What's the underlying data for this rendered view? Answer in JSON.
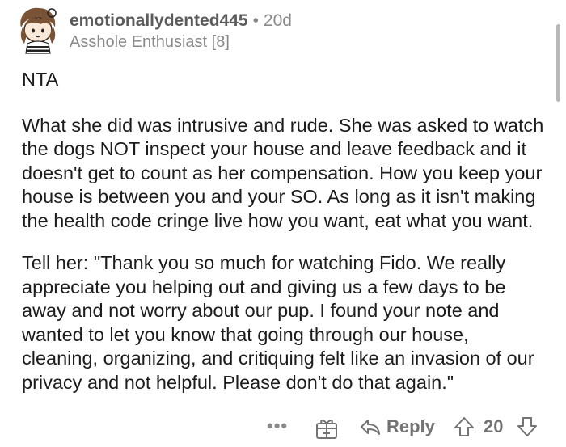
{
  "comment": {
    "author": "emotionallydented445",
    "separator": "•",
    "age": "20d",
    "flair": "Asshole Enthusiast [8]",
    "paragraphs": [
      "NTA",
      "What she did was intrusive and rude.  She was asked to watch the dogs NOT inspect your house and leave feedback and it doesn't get to count as her compensation. How you keep your house is between you and your SO.  As long as it isn't making the health code cringe live how you want, eat what you want.",
      "Tell her: \"Thank you so much for watching Fido. We really appreciate you helping out and giving us a few days to be away and not worry about our pup.  I found your note and wanted to let you know that going through our house, cleaning, organizing, and critiquing felt like an invasion of our privacy and not helpful.  Please don't do that again.\""
    ]
  },
  "actions": {
    "more": "•••",
    "award_icon": "gift-award-icon",
    "reply_icon": "reply-arrow-icon",
    "reply_label": "Reply",
    "upvote_icon": "upvote-arrow-icon",
    "score": "20",
    "downvote_icon": "downvote-arrow-icon"
  },
  "colors": {
    "text": "#1c1c1c",
    "meta": "#8a8a8a",
    "username": "#5b5b5b",
    "action": "#737373",
    "background": "#ffffff"
  }
}
